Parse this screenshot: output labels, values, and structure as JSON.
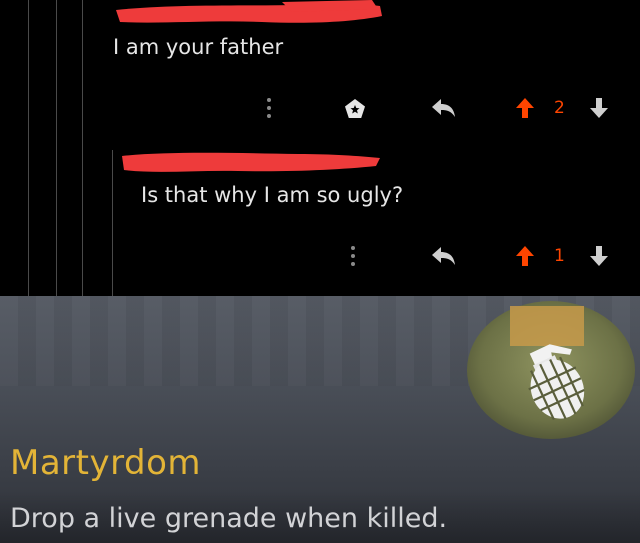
{
  "thread": {
    "comments": [
      {
        "text": "I am your father",
        "upvotes": "2"
      },
      {
        "text": "Is that why I am so ugly?",
        "upvotes": "1"
      }
    ]
  },
  "perk": {
    "title": "Martyrdom",
    "description": "Drop a live grenade when killed.",
    "icon": "grenade-icon"
  },
  "colors": {
    "upvote": "#ff4500",
    "redaction": "#ee3b3b",
    "perk_title": "#e3b437"
  }
}
